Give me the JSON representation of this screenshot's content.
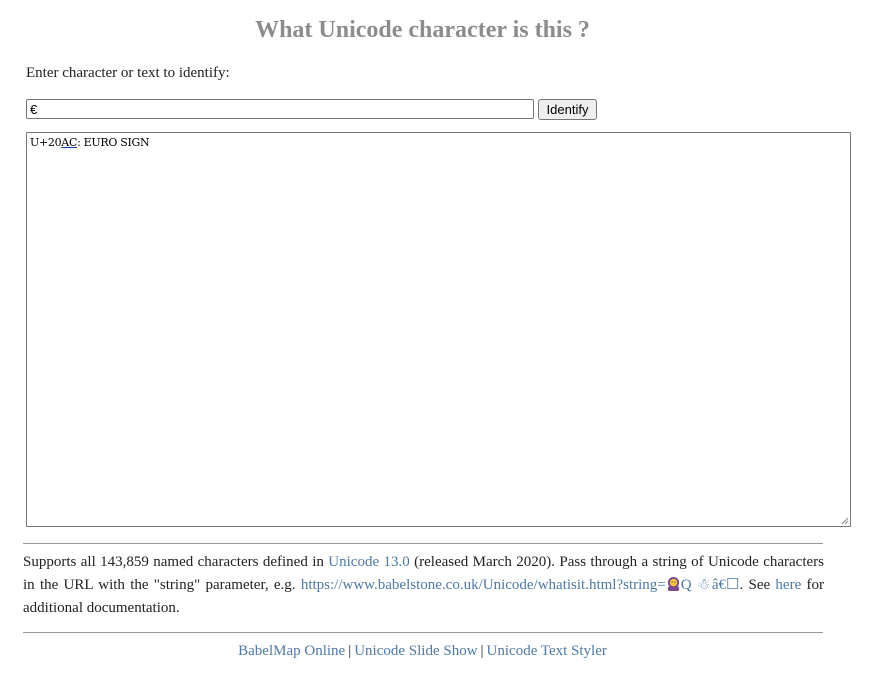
{
  "page": {
    "title": "What Unicode character is this ?",
    "prompt": "Enter character or text to identify:"
  },
  "form": {
    "input_value": "€",
    "identify_label": "Identify"
  },
  "output": {
    "lines": [
      {
        "code_prefix": "U+20",
        "code_link": "AC",
        "separator": ": ",
        "name": "EURO SIGN"
      }
    ]
  },
  "info": {
    "text_1": "Supports all 143,859 named characters defined in ",
    "unicode_link": "Unicode 13.0",
    "text_2": " (released March 2020). Pass through a string of Unicode characters in the URL with the \"string\" parameter, e.g. ",
    "example_url": "https://www.babelstone.co.uk/Unicode/whatisit.html?string=",
    "example_tail": "Q",
    "text_3_chars": "☃â€☐",
    "text_3": ". See ",
    "here_link": "here",
    "text_4": " for additional documentation."
  },
  "footer": {
    "links": [
      "BabelMap Online",
      "Unicode Slide Show",
      "Unicode Text Styler"
    ],
    "separator": "|"
  },
  "colors": {
    "title": "#8c8c8c",
    "link": "#4f79a3",
    "rule": "#9a9a9a"
  }
}
